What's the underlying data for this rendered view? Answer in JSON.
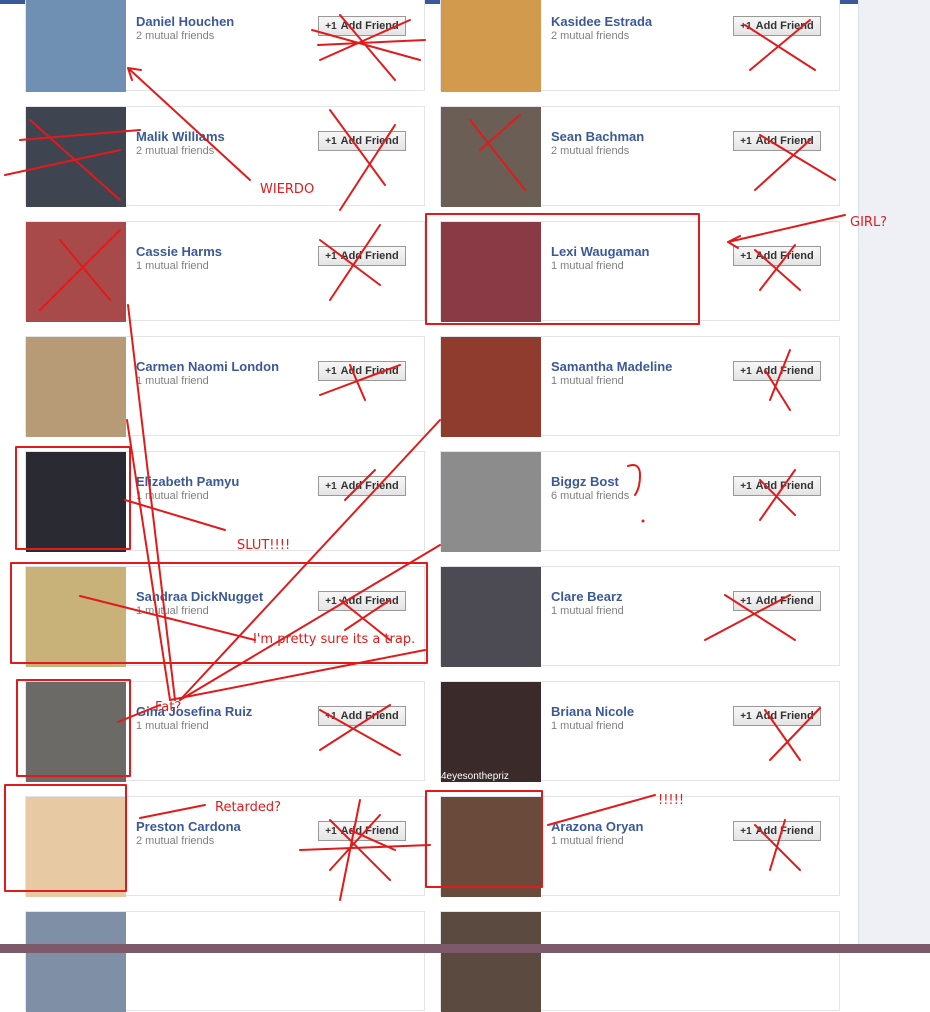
{
  "friends": [
    {
      "name": "Daniel Houchen",
      "mutual": "2 mutual friends",
      "button": "Add Friend",
      "photo_color": "#6f8fb3"
    },
    {
      "name": "Kasidee Estrada",
      "mutual": "2 mutual friends",
      "button": "Add Friend",
      "photo_color": "#d19a4c"
    },
    {
      "name": "Malik Williams",
      "mutual": "2 mutual friends",
      "button": "Add Friend",
      "photo_color": "#3e4450"
    },
    {
      "name": "Sean Bachman",
      "mutual": "2 mutual friends",
      "button": "Add Friend",
      "photo_color": "#6b5f55"
    },
    {
      "name": "Cassie Harms",
      "mutual": "1 mutual friend",
      "button": "Add Friend",
      "photo_color": "#a84a4a"
    },
    {
      "name": "Lexi Waugaman",
      "mutual": "1 mutual friend",
      "button": "Add Friend",
      "photo_color": "#8a3a44"
    },
    {
      "name": "Carmen Naomi London",
      "mutual": "1 mutual friend",
      "button": "Add Friend",
      "photo_color": "#b79a76"
    },
    {
      "name": "Samantha Madeline",
      "mutual": "1 mutual friend",
      "button": "Add Friend",
      "photo_color": "#8f3b2e"
    },
    {
      "name": "Elizabeth Pamyu",
      "mutual": "1 mutual friend",
      "button": "Add Friend",
      "photo_color": "#2a2a32"
    },
    {
      "name": "Biggz Bost",
      "mutual": "6 mutual friends",
      "button": "Add Friend",
      "photo_color": "#8c8c8c"
    },
    {
      "name": "Sandraa DickNugget",
      "mutual": "1 mutual friend",
      "button": "Add Friend",
      "photo_color": "#c9b17a"
    },
    {
      "name": "Clare Bearz",
      "mutual": "1 mutual friend",
      "button": "Add Friend",
      "photo_color": "#4c4a52"
    },
    {
      "name": "Gina Josefina Ruiz",
      "mutual": "1 mutual friend",
      "button": "Add Friend",
      "photo_color": "#6c6a66"
    },
    {
      "name": "Briana Nicole",
      "mutual": "1 mutual friend",
      "button": "Add Friend",
      "photo_color": "#3a2a2a"
    },
    {
      "name": "Preston Cardona",
      "mutual": "2 mutual friends",
      "button": "Add Friend",
      "photo_color": "#e7c9a4"
    },
    {
      "name": "Arazona Oryan",
      "mutual": "1 mutual friend",
      "button": "Add Friend",
      "photo_color": "#6a4a3a"
    },
    {
      "name": "",
      "mutual": "",
      "button": "",
      "photo_color": "#7f8fa5"
    },
    {
      "name": "",
      "mutual": "",
      "button": "",
      "photo_color": "#5b4a40"
    }
  ],
  "button_prefix": "+1",
  "photo_watermark": "4eyesonthepriz",
  "annotations": {
    "wierdo": "WIERDO",
    "girl": "GIRL?",
    "slut": "SLUT!!!!",
    "trap": "I'm pretty sure its a trap.",
    "fat": "Fat?",
    "retarded": "Retarded?",
    "exclaim": "!!!!!",
    "question": "?"
  },
  "colors": {
    "accent": "#3b5998",
    "ink": "#e01b1b"
  }
}
